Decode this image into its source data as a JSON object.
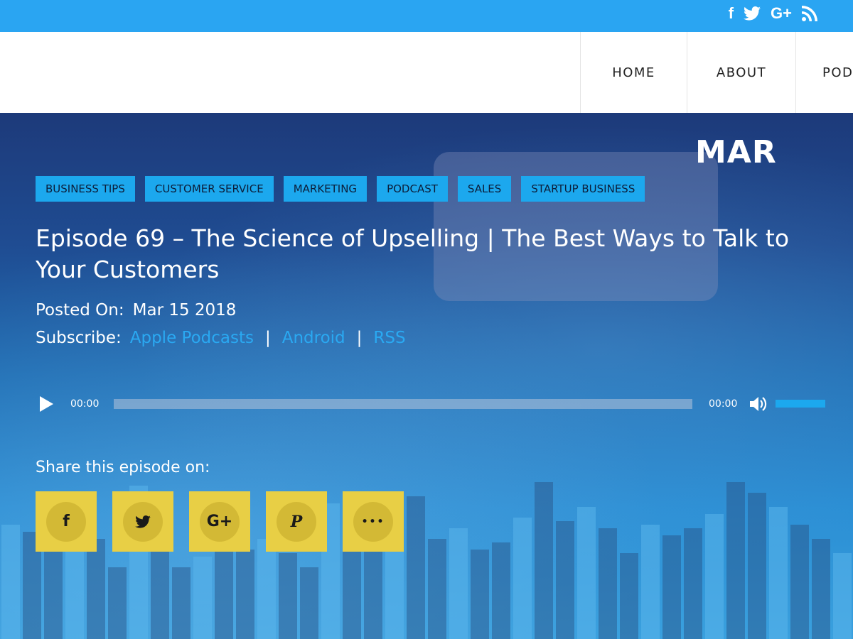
{
  "topbar": {
    "social": [
      {
        "icon": "facebook-icon",
        "glyph": "f"
      },
      {
        "icon": "twitter-icon",
        "glyph": "🐦"
      },
      {
        "icon": "google-plus-icon",
        "glyph": "G+"
      },
      {
        "icon": "rss-icon",
        "glyph": "⟡"
      }
    ]
  },
  "nav": {
    "home": "HOME",
    "about": "ABOUT",
    "pod": "POD"
  },
  "hero": {
    "month": "MAR",
    "tags": [
      "BUSINESS TIPS",
      "CUSTOMER SERVICE",
      "MARKETING",
      "PODCAST",
      "SALES",
      "STARTUP BUSINESS"
    ],
    "title": "Episode 69 – The Science of Upselling | The Best Ways to Talk to Your Customers",
    "posted_label": "Posted On:",
    "posted_date": "Mar 15 2018",
    "subscribe_label": "Subscribe:",
    "subscribe_links": [
      "Apple Podcasts",
      "Android",
      "RSS"
    ],
    "separator": "|"
  },
  "player": {
    "current_time": "00:00",
    "duration": "00:00",
    "progress": 0,
    "volume": 1.0
  },
  "share": {
    "label": "Share this episode on:",
    "buttons": [
      {
        "icon": "facebook-icon",
        "glyph": "f"
      },
      {
        "icon": "twitter-icon",
        "glyph": "🐦"
      },
      {
        "icon": "google-plus-icon",
        "glyph": "G+"
      },
      {
        "icon": "pinterest-icon",
        "glyph": "P"
      },
      {
        "icon": "more-icon",
        "glyph": "•••"
      }
    ]
  },
  "colors": {
    "topbar": "#2aa5f2",
    "tag_bg": "#1ca8ee",
    "link": "#2aa9f2",
    "share_bg": "#e8cf45"
  }
}
